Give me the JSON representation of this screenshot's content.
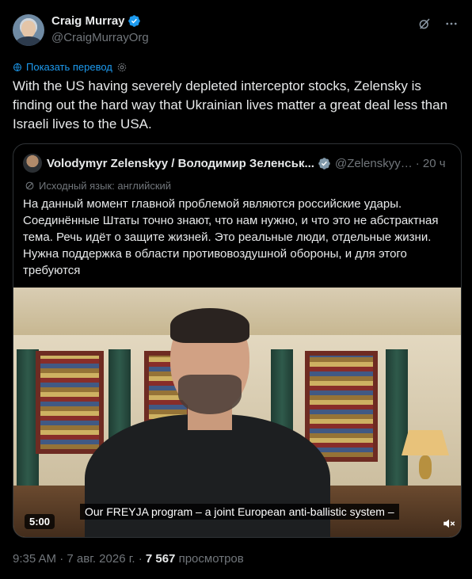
{
  "tweet": {
    "author_name": "Craig Murray",
    "author_handle": "@CraigMurrayOrg",
    "translate_label": "Показать перевод",
    "text": "With the US having severely depleted interceptor stocks, Zelensky is finding out the hard way that Ukrainian lives matter a great deal less than Israeli lives to the USA."
  },
  "quote": {
    "author_name": "Volodymyr Zelenskyy / Володимир Зеленськ...",
    "author_handle": "@Zelenskyy…",
    "time": "· 20 ч",
    "lang_note": "Исходный язык: английский",
    "text": "На данный момент главной проблемой являются российские удары. Соединённые Штаты точно знают, что нам нужно, и что это не абстрактная тема. Речь идёт о защите жизней. Это реальные люди, отдельные жизни. Нужна поддержка в области противовоздушной обороны, и для этого требуются",
    "video": {
      "duration": "5:00",
      "caption": "Our FREYJA program – a joint European anti-ballistic system –"
    }
  },
  "meta": {
    "time": "9:35 AM",
    "date": "· 7 авг. 2026 г. ·",
    "views_count": "7 567",
    "views_label": "просмотров"
  },
  "colors": {
    "background": "#000000",
    "text": "#e7e9ea",
    "secondary": "#71767b",
    "accent": "#1d9bf0",
    "border": "#2f3336"
  },
  "icons": [
    "verified-badge-icon",
    "grok-icon",
    "more-icon",
    "translate-icon",
    "settings-icon",
    "mute-icon"
  ]
}
